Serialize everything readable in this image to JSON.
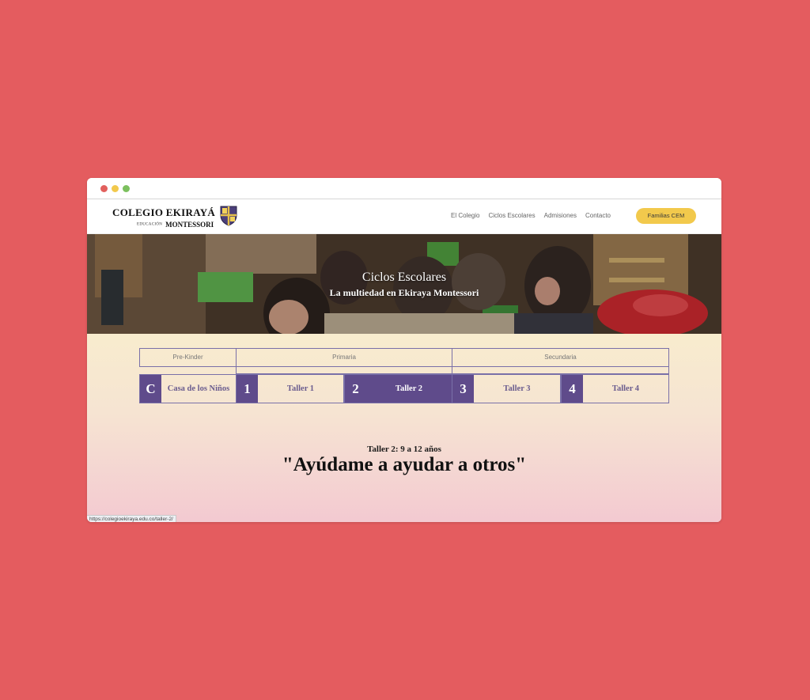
{
  "brand": {
    "name": "COLEGIO EKIRAYÁ",
    "tagline_small": "EDUCACIÓN",
    "tagline_main": "MONTESSORI"
  },
  "nav": {
    "items": [
      "El Colegio",
      "Ciclos Escolares",
      "Admisiones",
      "Contacto"
    ],
    "cta": "Familias CEM"
  },
  "hero": {
    "title": "Ciclos Escolares",
    "subtitle": "La multiedad en Ekiraya Montessori"
  },
  "cycles": [
    "Pre-Kinder",
    "Primaria",
    "Secundaria"
  ],
  "tabs": [
    {
      "num": "C",
      "label": "Casa de los Niños",
      "active": false
    },
    {
      "num": "1",
      "label": "Taller 1",
      "active": false
    },
    {
      "num": "2",
      "label": "Taller 2",
      "active": true
    },
    {
      "num": "3",
      "label": "Taller 3",
      "active": false
    },
    {
      "num": "4",
      "label": "Taller 4",
      "active": false
    }
  ],
  "section": {
    "small": "Taller 2: 9 a 12 años",
    "big": "\"Ayúdame a ayudar a otros\""
  },
  "status_url": "https://colegioekiraya.edu.co/taller-2/",
  "colors": {
    "background": "#e45c5f",
    "accent_purple": "#5f4b8b",
    "cta_yellow": "#f2c94c"
  }
}
